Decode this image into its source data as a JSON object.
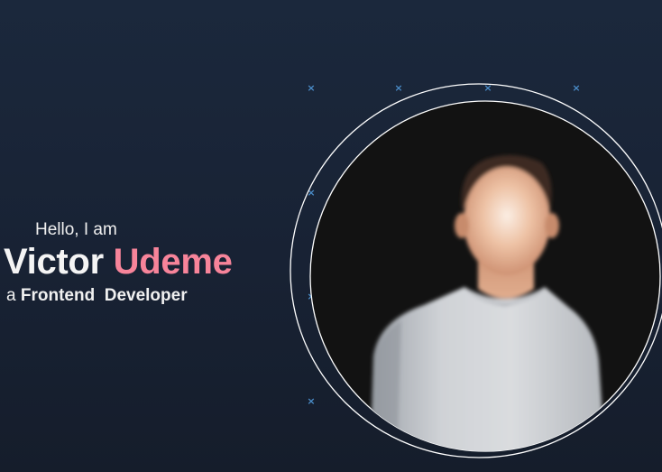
{
  "hero": {
    "greeting": "Hello, I am",
    "first_name": "Victor",
    "last_name": "Udeme",
    "role_prefix": "a",
    "role": "Frontend  Developer"
  },
  "colors": {
    "background_top": "#1b283c",
    "background_bottom": "#151d2b",
    "accent": "#f7849a",
    "marker": "#4a8cc8",
    "ring": "#ffffff"
  },
  "decorations": {
    "marker_glyph": "×",
    "marker_icon": "x-mark-icon"
  },
  "avatar": {
    "icon": "person-avatar-icon"
  }
}
